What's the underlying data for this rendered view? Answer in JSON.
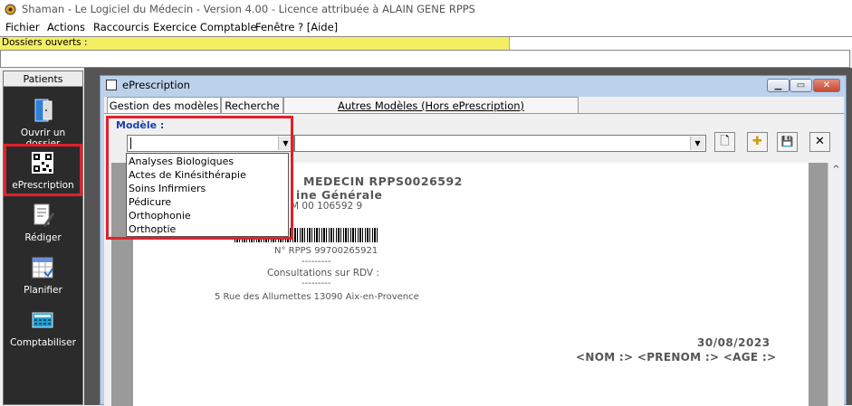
{
  "app": {
    "title": "Shaman - Le Logiciel du Médecin - Version 4.00 - Licence attribuée à ALAIN GENE RPPS"
  },
  "menu": [
    "Fichier",
    "Actions",
    "Raccourcis",
    "Exercice Comptable",
    "Fenêtre",
    "? [Aide]"
  ],
  "dossiers": {
    "label": "Dossiers ouverts :"
  },
  "sidebar": {
    "header": "Patients",
    "items": [
      {
        "label": "Ouvrir un dossier",
        "icon": "folder-door-icon"
      },
      {
        "label": "ePrescription",
        "icon": "qr-code-icon"
      },
      {
        "label": "Rédiger",
        "icon": "write-document-icon"
      },
      {
        "label": "Planifier",
        "icon": "calendar-icon"
      },
      {
        "label": "Comptabiliser",
        "icon": "calculator-icon"
      }
    ]
  },
  "window": {
    "title": "ePrescription",
    "minimize": "▁",
    "restore": "▭",
    "close": "✕"
  },
  "tabs": [
    "Gestion des modèles",
    "Recherche",
    "Autres Modèles (Hors ePrescription)"
  ],
  "modele": {
    "label": "Modèle :",
    "value": "",
    "options": [
      "Analyses Biologiques",
      "Actes de Kinésithérapie",
      "Soins Infirmiers",
      "Pédicure",
      "Orthophonie",
      "Orthoptie"
    ]
  },
  "toolbar": {
    "new": "🗋",
    "add": "✚",
    "save": "💾",
    "delete": "✕"
  },
  "document": {
    "doctor": "MEDECIN RPPS0026592",
    "specialty": "ine Générale",
    "am": "M 00 106592 9",
    "rpps": "N° RPPS 99700265921",
    "sep": "---------",
    "consult": "Consultations sur RDV :",
    "address": "5 Rue des Allumettes 13090 Aix-en-Provence",
    "date": "30/08/2023",
    "patient": "<NOM :> <PRENOM :> <AGE :>"
  },
  "colors": {
    "highlight": "#e3202b",
    "dossiers_strip": "#f4ee64",
    "modele_label": "#1b3fb3"
  }
}
